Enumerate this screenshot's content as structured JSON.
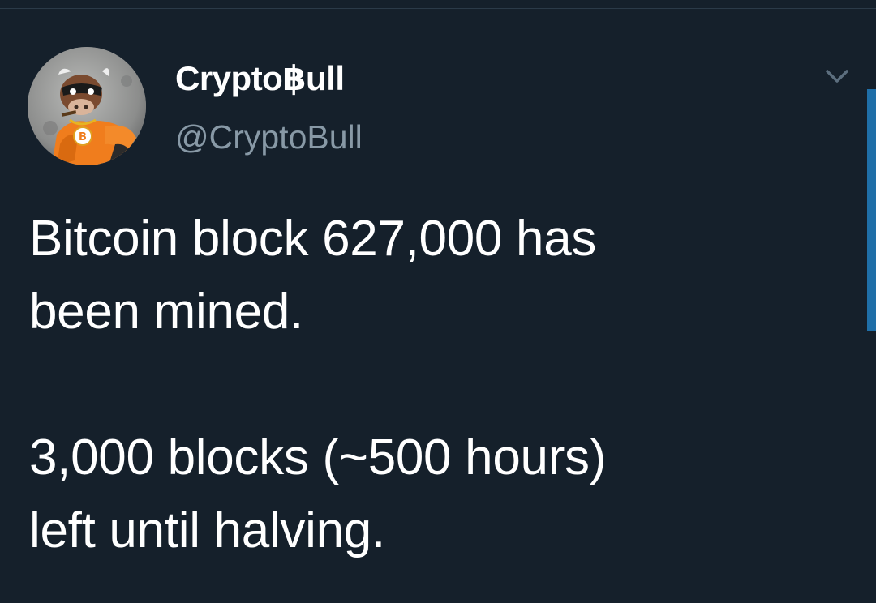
{
  "tweet": {
    "author": {
      "display_name": "Crypto฿ull",
      "handle": "@CryptoBull",
      "avatar_icon": "bull-mascot-avatar"
    },
    "menu_icon": "chevron-down-icon",
    "text": {
      "line_1": "Bitcoin block 627,000 has",
      "line_2": "been mined.",
      "line_3": "3,000 blocks (~500 hours)",
      "line_4": "left until halving."
    }
  },
  "colors": {
    "background": "#15202b",
    "primary_text": "#ffffff",
    "secondary_text": "#8899a6",
    "scroll_indicator": "#1f6fa8"
  }
}
